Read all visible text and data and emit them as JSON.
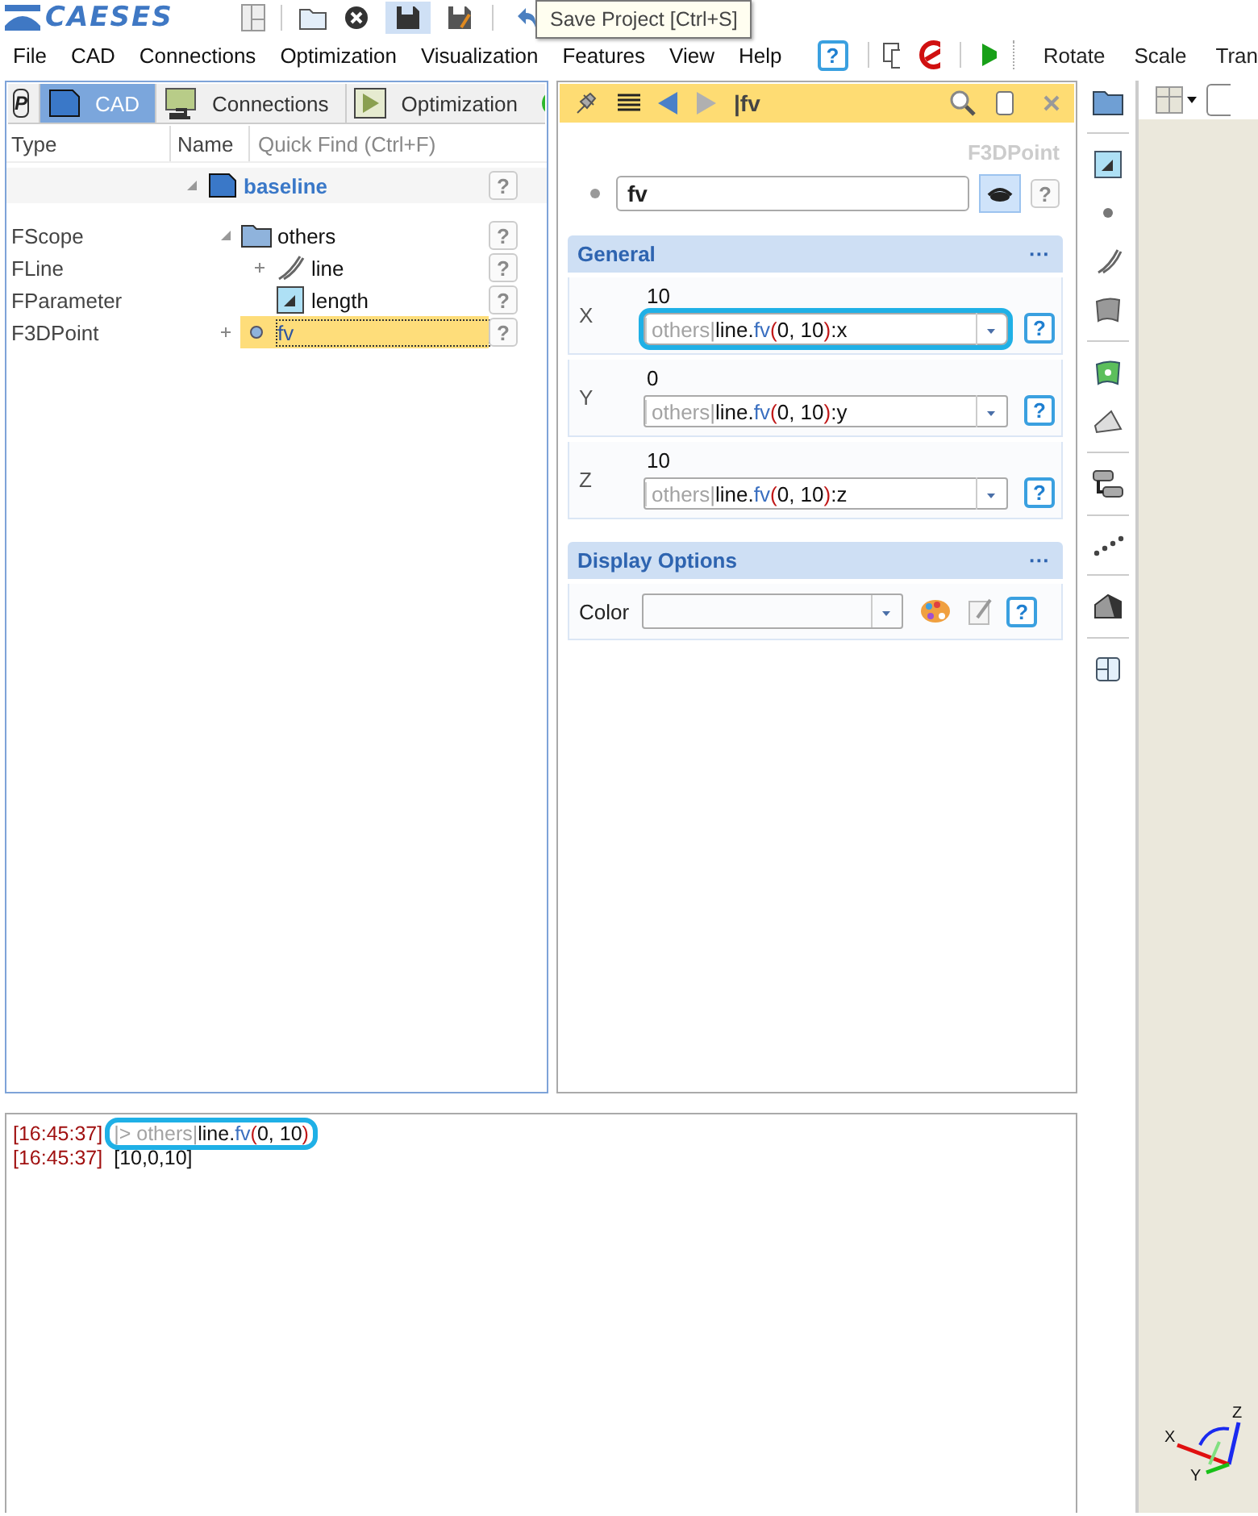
{
  "app": {
    "logo": "CAESES"
  },
  "menu": [
    "File",
    "CAD",
    "Connections",
    "Optimization",
    "Visualization",
    "Features",
    "View",
    "Help"
  ],
  "menu_help": "?",
  "quick_actions": [
    "Rotate",
    "Scale",
    "Tran"
  ],
  "tooltip": "Save Project [Ctrl+S]",
  "left_panel": {
    "pin_label": "P",
    "tabs": [
      {
        "label": "CAD",
        "kind": "cad",
        "selected": true
      },
      {
        "label": "Connections",
        "kind": "connections",
        "selected": false
      },
      {
        "label": "Optimization",
        "kind": "optimization",
        "selected": false
      }
    ],
    "columns": [
      "Type",
      "Name"
    ],
    "quick_find": {
      "placeholder": "Quick Find (Ctrl+F)"
    },
    "tree": [
      {
        "name": "baseline",
        "kind": "root",
        "expanded": true,
        "selected": false,
        "help": "?",
        "children": [
          {
            "type": "FScope",
            "name": "others",
            "kind": "folder",
            "expanded": true,
            "selected": false,
            "help": "?",
            "children": [
              {
                "type": "FLine",
                "name": "line",
                "kind": "curve",
                "expanded": false,
                "selected": false,
                "help": "?"
              },
              {
                "type": "FParameter",
                "name": "length",
                "kind": "parameter",
                "selected": false,
                "help": "?"
              }
            ]
          },
          {
            "type": "F3DPoint",
            "name": "fv",
            "kind": "point",
            "expanded": false,
            "selected": true,
            "help": "?"
          }
        ]
      }
    ]
  },
  "properties": {
    "title": "|fv",
    "back": {
      "disabled": false
    },
    "forward": {
      "disabled": true
    },
    "object_type": "F3DPoint",
    "name_field": {
      "value": "fv",
      "help": "?"
    },
    "sections": [
      {
        "title": "General",
        "menu": "···",
        "kind": "coords",
        "rows": [
          {
            "label": "X",
            "value": "10",
            "highlighted": true,
            "help": "?",
            "expression": [
              {
                "kind": "scope",
                "text": "others|"
              },
              {
                "kind": "plain",
                "text": "line."
              },
              {
                "kind": "func",
                "text": "fv"
              },
              {
                "kind": "paren",
                "text": "("
              },
              {
                "kind": "plain",
                "text": "0, 10"
              },
              {
                "kind": "paren",
                "text": ")"
              },
              {
                "kind": "plain",
                "text": ":x"
              }
            ]
          },
          {
            "label": "Y",
            "value": "0",
            "highlighted": false,
            "help": "?",
            "expression": [
              {
                "kind": "scope",
                "text": "others|"
              },
              {
                "kind": "plain",
                "text": "line."
              },
              {
                "kind": "func",
                "text": "fv"
              },
              {
                "kind": "paren",
                "text": "("
              },
              {
                "kind": "plain",
                "text": "0, 10"
              },
              {
                "kind": "paren",
                "text": ")"
              },
              {
                "kind": "plain",
                "text": ":y"
              }
            ]
          },
          {
            "label": "Z",
            "value": "10",
            "highlighted": false,
            "help": "?",
            "expression": [
              {
                "kind": "scope",
                "text": "others|"
              },
              {
                "kind": "plain",
                "text": "line."
              },
              {
                "kind": "func",
                "text": "fv"
              },
              {
                "kind": "paren",
                "text": "("
              },
              {
                "kind": "plain",
                "text": "0, 10"
              },
              {
                "kind": "paren",
                "text": ")"
              },
              {
                "kind": "plain",
                "text": ":z"
              }
            ]
          }
        ]
      },
      {
        "title": "Display Options",
        "menu": "···",
        "kind": "display",
        "color": {
          "label": "Color",
          "help": "?"
        }
      }
    ]
  },
  "console": [
    {
      "time": "[16:45:37]",
      "highlighted": true,
      "parts": [
        {
          "kind": "scope",
          "text": "|> others|"
        },
        {
          "kind": "plain",
          "text": "line."
        },
        {
          "kind": "func",
          "text": "fv"
        },
        {
          "kind": "paren",
          "text": "("
        },
        {
          "kind": "plain",
          "text": "0, 10"
        },
        {
          "kind": "paren",
          "text": ")"
        }
      ]
    },
    {
      "time": "[16:45:37]",
      "highlighted": false,
      "parts": [
        {
          "kind": "plain",
          "text": "[10,0,10]"
        }
      ]
    }
  ],
  "viewport": {
    "axes": [
      "X",
      "Y",
      "Z"
    ]
  }
}
